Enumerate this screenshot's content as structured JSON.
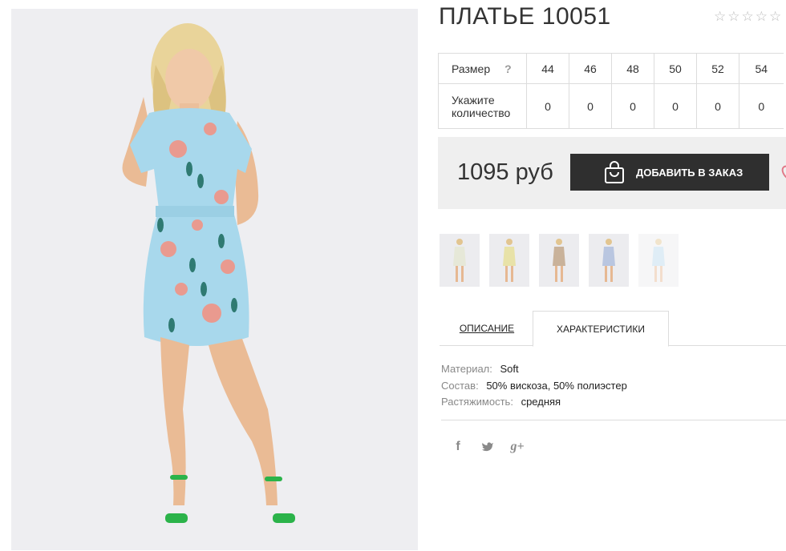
{
  "product": {
    "title": "ПЛАТЬЕ 10051",
    "rating_stars": [
      "☆",
      "☆",
      "☆",
      "☆",
      "☆"
    ]
  },
  "sizes": {
    "size_label": "Размер",
    "help": "?",
    "qty_label_line1": "Укажите",
    "qty_label_line2": "количество",
    "values": [
      "44",
      "46",
      "48",
      "50",
      "52",
      "54"
    ],
    "quantities": [
      "0",
      "0",
      "0",
      "0",
      "0",
      "0"
    ]
  },
  "order": {
    "price": "1095 руб",
    "button_label": "ДОБАВИТЬ В ЗАКАЗ",
    "icon": "shopping-bag-icon",
    "wishlist_icon": "heart-icon"
  },
  "thumbnails": [
    {
      "name": "thumbnail-1",
      "dress": "#e6e8d8"
    },
    {
      "name": "thumbnail-2",
      "dress": "#e8e2a8"
    },
    {
      "name": "thumbnail-3",
      "dress": "#c9b29a"
    },
    {
      "name": "thumbnail-4",
      "dress": "#b9c6e0"
    },
    {
      "name": "thumbnail-5",
      "dress": "#b9d9ec"
    }
  ],
  "tabs": {
    "description": "ОПИСАНИЕ",
    "characteristics": "ХАРАКТЕРИСТИКИ"
  },
  "properties": [
    {
      "key": "Материал:",
      "value": "Soft"
    },
    {
      "key": "Состав:",
      "value": "50% вискоза, 50% полиэстер"
    },
    {
      "key": "Растяжимость:",
      "value": "средняя"
    }
  ],
  "social": {
    "facebook": "f",
    "twitter": "🐦",
    "googleplus": "g+"
  },
  "colors": {
    "accent_dark": "#2f2f2f",
    "price_box_bg": "#efefef",
    "dress_blue": "#a8d8ec",
    "shoes_green": "#2bb34a",
    "heart": "#e07a88"
  }
}
